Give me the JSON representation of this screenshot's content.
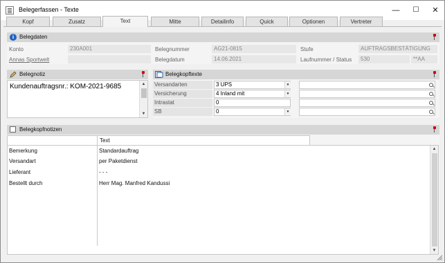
{
  "window": {
    "title": "Belegerfassen - Texte",
    "minimize": "—",
    "maximize": "☐",
    "close": "✕"
  },
  "tabs": [
    {
      "label": "Kopf"
    },
    {
      "label": "Zusatz"
    },
    {
      "label": "Text"
    },
    {
      "label": "Mitte"
    },
    {
      "label": "Detailinfo"
    },
    {
      "label": "Quick"
    },
    {
      "label": "Optionen"
    },
    {
      "label": "Vertreter"
    }
  ],
  "active_tab": "Text",
  "belegdaten": {
    "title": "Belegdaten",
    "konto_label": "Konto",
    "konto_value": "230A001",
    "kunde_link": "Annas Sportwelt",
    "belegnummer_label": "Belegnummer",
    "belegnummer_value": "AG21-0815",
    "belegdatum_label": "Belegdatum",
    "belegdatum_value": "14.06.2021",
    "stufe_label": "Stufe",
    "stufe_value": "AUFTRAGSBESTÄTIGUNG",
    "laufnummer_label": "Laufnummer / Status",
    "laufnummer_value": "530",
    "status_value": "**AA"
  },
  "belegnotiz": {
    "title": "Belegnotiz",
    "text": "Kundenauftragsnr.: KOM-2021-9685"
  },
  "belegkopftexte": {
    "title": "Belegkopftexte",
    "rows": [
      {
        "label": "Versandarten",
        "value": "3  UPS",
        "has_dropdown": true
      },
      {
        "label": "Versicherung",
        "value": "4  Inland mit",
        "has_dropdown": true
      },
      {
        "label": "Intrastat",
        "value": "0",
        "has_dropdown": false
      },
      {
        "label": "SB",
        "value": "0",
        "has_dropdown": true
      }
    ]
  },
  "belegkopfnotizen": {
    "title": "Belegkopfnotizen",
    "column_header": "Text",
    "rows": [
      {
        "label": "Bemerkung",
        "value": "Standardauftrag"
      },
      {
        "label": "Versandart",
        "value": "per Paketdienst"
      },
      {
        "label": "Lieferant",
        "value": "- - -"
      },
      {
        "label": "Bestellt durch",
        "value": "Herr Mag. Manfred Kandussi"
      }
    ]
  },
  "colors": {
    "header_bg": "#d6d6d6",
    "panel_bg": "#f4f4f4",
    "pin_red": "#cc0000",
    "info_blue": "#1f62c2"
  }
}
